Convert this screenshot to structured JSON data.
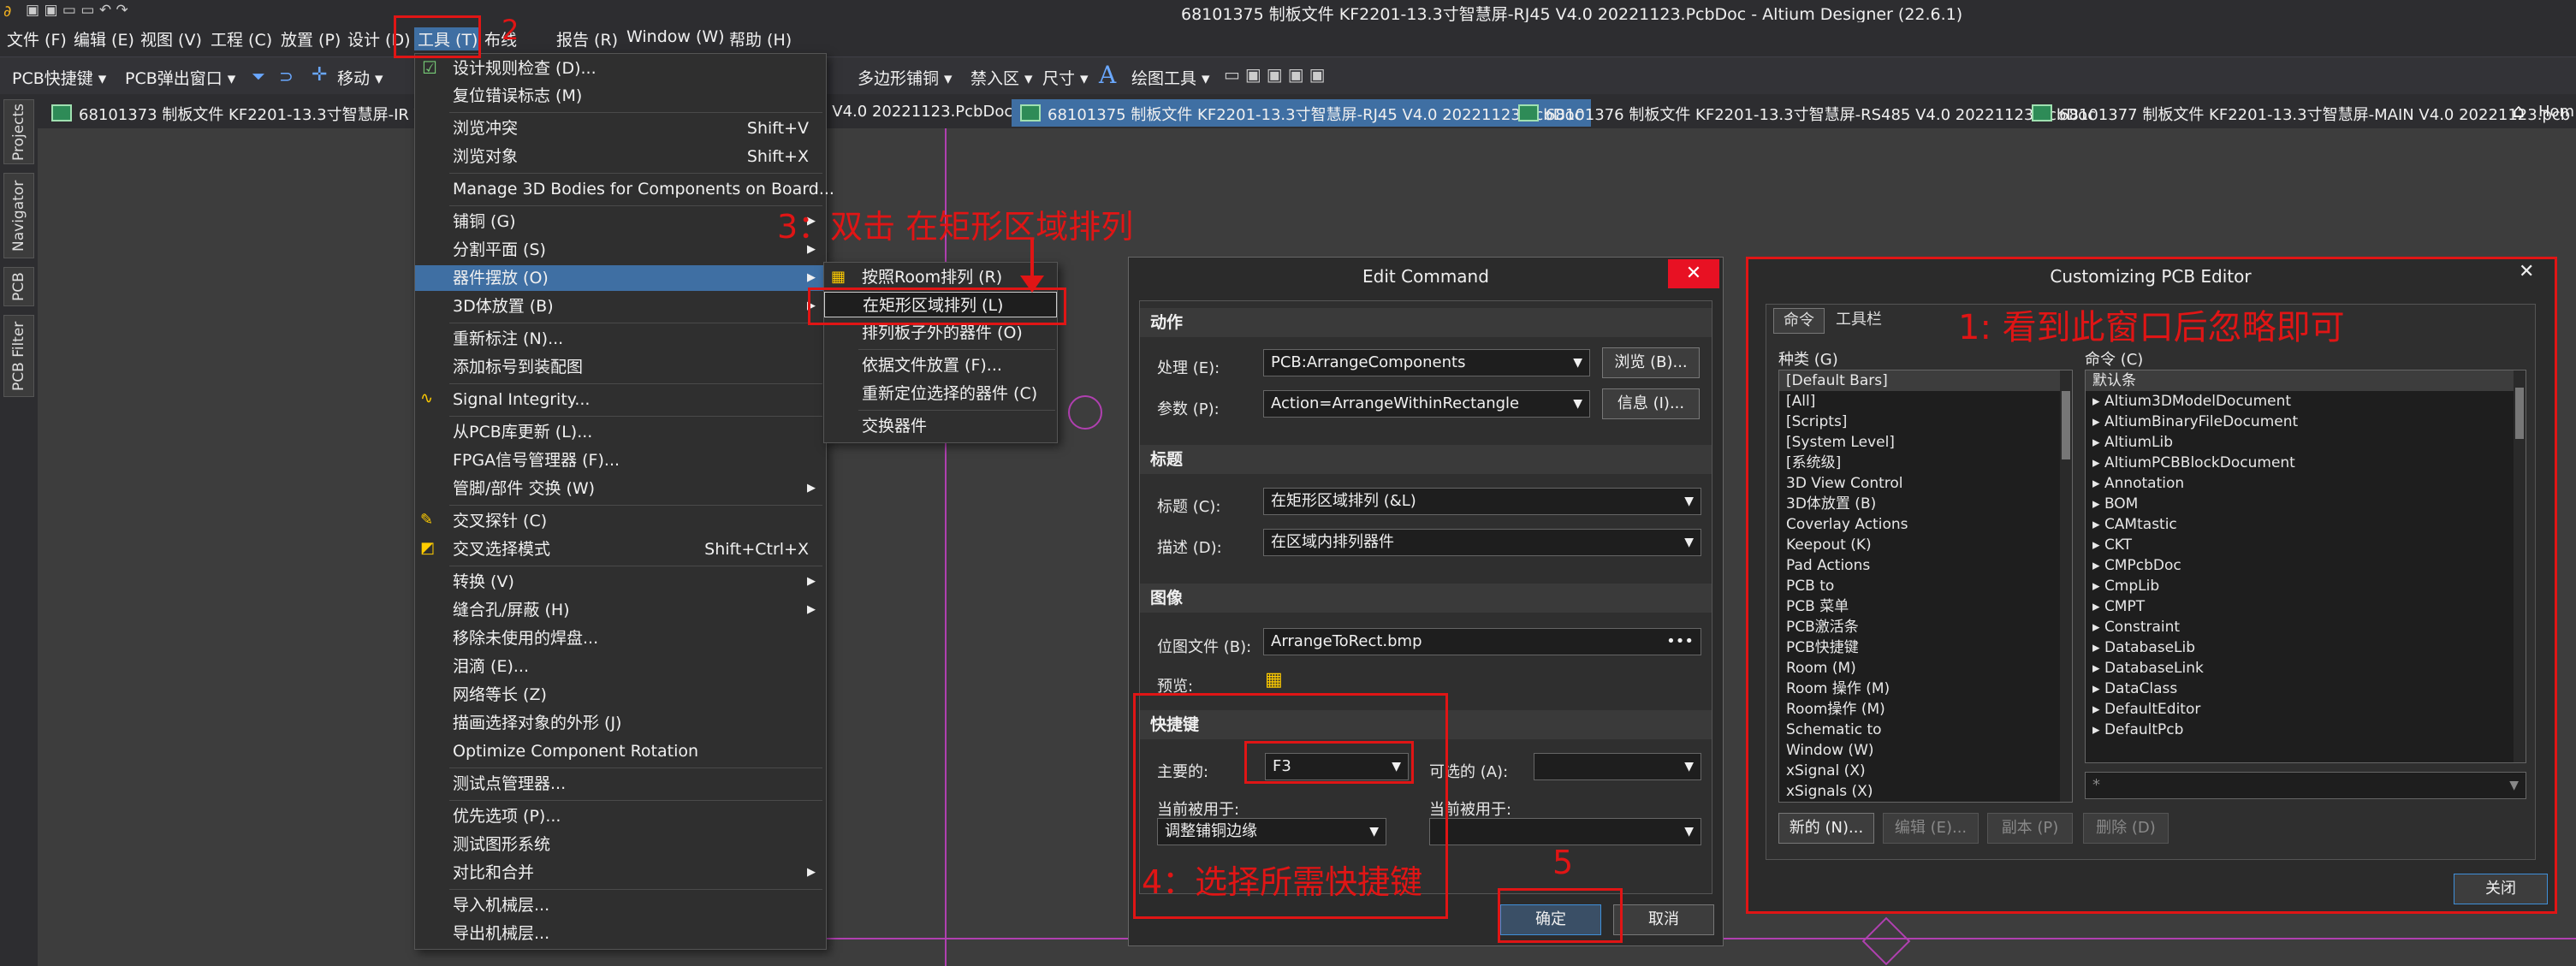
{
  "window": {
    "title": "68101375 制板文件 KF2201-13.3寸智慧屏-RJ45 V4.0 20221123.PcbDoc - Altium Designer (22.6.1)"
  },
  "menubar": [
    "文件 (F)",
    "编辑 (E)",
    "视图 (V)",
    "工程 (C)",
    "放置 (P)",
    "设计 (D)",
    "工具 (T)",
    "布线",
    "报告 (R)",
    "Window (W)",
    "帮助 (H)"
  ],
  "toolbar": {
    "left": [
      "PCB快捷键 ▾",
      "PCB弹出窗口 ▾",
      "移动 ▾"
    ],
    "right": [
      "多边形铺铜 ▾",
      "禁入区 ▾",
      "尺寸 ▾",
      "绘图工具 ▾"
    ]
  },
  "tabs": [
    "68101373 制板文件 KF2201-13.3寸智慧屏-IR V4.0",
    "C V4.0 20221123.PcbDoc *",
    "68101375 制板文件 KF2201-13.3寸智慧屏-RJ45 V4.0 20221123.PcbDoc",
    "68101376 制板文件 KF2201-13.3寸智慧屏-RS485 V4.0 20221123.PcbDoc",
    "68101377 制板文件 KF2201-13.3寸智慧屏-MAIN V4.0 20221123.pcb",
    "Hom"
  ],
  "side_panels": [
    "Projects",
    "Navigator",
    "PCB",
    "PCB Filter"
  ],
  "tools_menu": [
    {
      "label": "设计规则检查 (D)...",
      "shortcut": ""
    },
    {
      "label": "复位错误标志 (M)",
      "shortcut": ""
    },
    {
      "label": "浏览冲突",
      "shortcut": "Shift+V"
    },
    {
      "label": "浏览对象",
      "shortcut": "Shift+X"
    },
    {
      "label": "Manage 3D Bodies for Components on Board...",
      "shortcut": ""
    },
    {
      "label": "铺铜 (G)",
      "shortcut": ""
    },
    {
      "label": "分割平面 (S)",
      "shortcut": ""
    },
    {
      "label": "器件摆放 (O)",
      "shortcut": ""
    },
    {
      "label": "3D体放置 (B)",
      "shortcut": ""
    },
    {
      "label": "重新标注 (N)...",
      "shortcut": ""
    },
    {
      "label": "添加标号到装配图",
      "shortcut": ""
    },
    {
      "label": "Signal Integrity...",
      "shortcut": ""
    },
    {
      "label": "从PCB库更新 (L)...",
      "shortcut": ""
    },
    {
      "label": "FPGA信号管理器 (F)...",
      "shortcut": ""
    },
    {
      "label": "管脚/部件 交换 (W)",
      "shortcut": ""
    },
    {
      "label": "交叉探针 (C)",
      "shortcut": ""
    },
    {
      "label": "交叉选择模式",
      "shortcut": "Shift+Ctrl+X"
    },
    {
      "label": "转换 (V)",
      "shortcut": ""
    },
    {
      "label": "缝合孔/屏蔽 (H)",
      "shortcut": ""
    },
    {
      "label": "移除未使用的焊盘...",
      "shortcut": ""
    },
    {
      "label": "泪滴 (E)...",
      "shortcut": ""
    },
    {
      "label": "网络等长 (Z)",
      "shortcut": ""
    },
    {
      "label": "描画选择对象的外形 (J)",
      "shortcut": ""
    },
    {
      "label": "Optimize Component Rotation",
      "shortcut": ""
    },
    {
      "label": "测试点管理器...",
      "shortcut": ""
    },
    {
      "label": "优先选项 (P)...",
      "shortcut": ""
    },
    {
      "label": "测试图形系统",
      "shortcut": ""
    },
    {
      "label": "对比和合并",
      "shortcut": ""
    },
    {
      "label": "导入机械层...",
      "shortcut": ""
    },
    {
      "label": "导出机械层...",
      "shortcut": ""
    }
  ],
  "submenu": [
    "按照Room排列 (R)",
    "在矩形区域排列 (L)",
    "排列板子外的器件 (O)",
    "依据文件放置 (F)...",
    "重新定位选择的器件 (C)",
    "交换器件"
  ],
  "edit_command": {
    "title": "Edit Command",
    "sec_action": "动作",
    "process_label": "处理 (E):",
    "process_value": "PCB:ArrangeComponents",
    "browse": "浏览 (B)...",
    "param_label": "参数 (P):",
    "param_value": "Action=ArrangeWithinRectangle",
    "info": "信息 (I)...",
    "sec_title": "标题",
    "caption_label": "标题 (C):",
    "caption_value": "在矩形区域排列 (&L)",
    "desc_label": "描述 (D):",
    "desc_value": "在区域内排列器件",
    "sec_image": "图像",
    "bitmap_label": "位图文件 (B):",
    "bitmap_value": "ArrangeToRect.bmp",
    "preview_label": "预览:",
    "sec_shortcut": "快捷键",
    "primary_label": "主要的:",
    "primary_value": "F3",
    "alt_label": "可选的 (A):",
    "alt_value": "",
    "used_by1": "当前被用于:",
    "used_by1_value": "调整铺铜边缘",
    "used_by2": "当前被用于:",
    "used_by2_value": "",
    "ok": "确定",
    "cancel": "取消"
  },
  "customizing": {
    "title": "Customizing PCB Editor",
    "tabs": [
      "命令",
      "工具栏"
    ],
    "categories_label": "种类 (G)",
    "commands_label": "命令 (C)",
    "categories": [
      "[Default Bars]",
      "[All]",
      "[Scripts]",
      "[System Level]",
      "[系统级]",
      "3D View Control",
      "3D体放置 (B)",
      "Coverlay Actions",
      "Keepout (K)",
      "Pad Actions",
      "PCB to",
      "PCB 菜单",
      "PCB激活条",
      "PCB快捷键",
      "Room (M)",
      "Room 操作 (M)",
      "Room操作 (M)",
      "Schematic to",
      "Window (W)",
      "xSignal (X)",
      "xSignals (X)"
    ],
    "commands_header": "默认条",
    "commands": [
      "Altium3DModelDocument",
      "AltiumBinaryFileDocument",
      "AltiumLib",
      "AltiumPCBBlockDocument",
      "Annotation",
      "BOM",
      "CAMtastic",
      "CKT",
      "CMPcbDoc",
      "CmpLib",
      "CMPT",
      "Constraint",
      "DatabaseLib",
      "DatabaseLink",
      "DataClass",
      "DefaultEditor",
      "DefaultPcb"
    ],
    "new": "新的 (N)...",
    "edit": "编辑 (E)...",
    "copy": "副本 (P)",
    "delete": "删除 (D)",
    "close": "关闭"
  },
  "annotations": {
    "a1": "1: 看到此窗口后忽略即可",
    "a2": "2",
    "a3": "3：双击 在矩形区域排列",
    "a4": "4：选择所需快捷键",
    "a5": "5"
  },
  "colors": {
    "annotation": "#e01515",
    "menu_highlight": "#3f6fa3",
    "canvas": "#3d3d3d",
    "board_trace": "#b040b0"
  }
}
